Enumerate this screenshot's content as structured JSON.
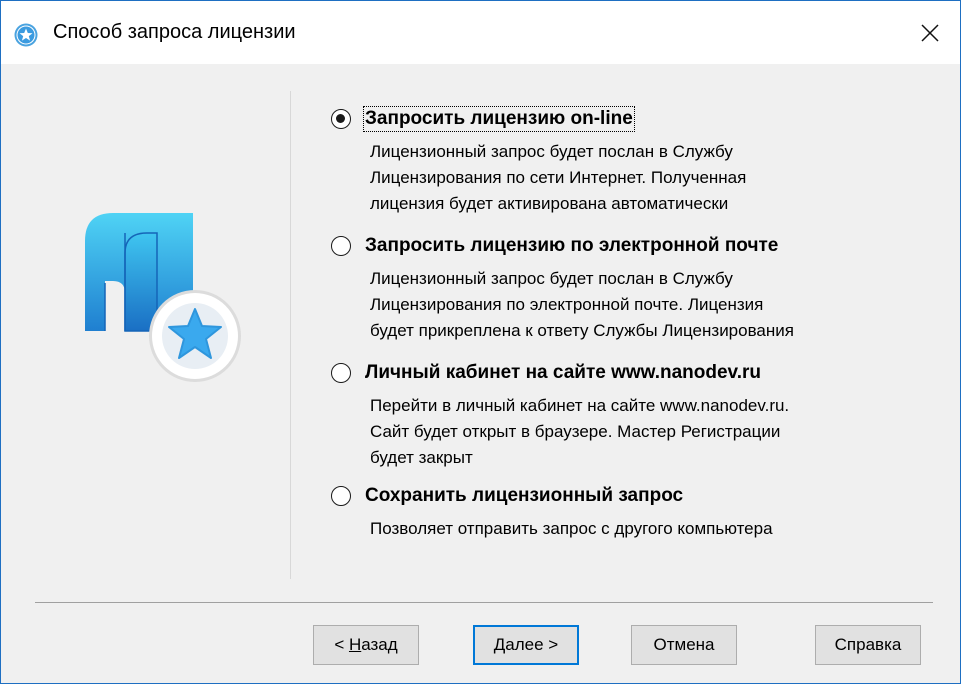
{
  "window": {
    "title": "Способ запроса лицензии",
    "close_glyph": "✕",
    "accent": "#1e6fc2"
  },
  "options": [
    {
      "title": "Запросить лицензию on-line",
      "description": "Лицензионный запрос будет послан в Службу\nЛицензирования по сети Интернет. Полученная\nлицензия будет активирована автоматически",
      "selected": true
    },
    {
      "title": "Запросить лицензию по электронной почте",
      "description": "Лицензионный запрос будет послан в Службу\nЛицензирования по электронной почте. Лицензия\nбудет прикреплена к ответу Службы Лицензирования",
      "selected": false
    },
    {
      "title": "Личный кабинет на сайте www.nanodev.ru",
      "description": "Перейти в личный кабинет на сайте www.nanodev.ru.\nСайт будет открыт в браузере. Мастер Регистрации\nбудет закрыт",
      "selected": false
    },
    {
      "title": "Сохранить лицензионный запрос",
      "description": "Позволяет отправить запрос с другого компьютера",
      "selected": false
    }
  ],
  "buttons": {
    "back_prefix": "< ",
    "back_underlined": "Н",
    "back_rest": "азад",
    "next_underlined": "Д",
    "next_rest": "алее >",
    "cancel": "Отмена",
    "help": "Справка"
  },
  "icons": {
    "title_icon": "star-badge-icon",
    "logo": "nanocad-logo-icon"
  }
}
